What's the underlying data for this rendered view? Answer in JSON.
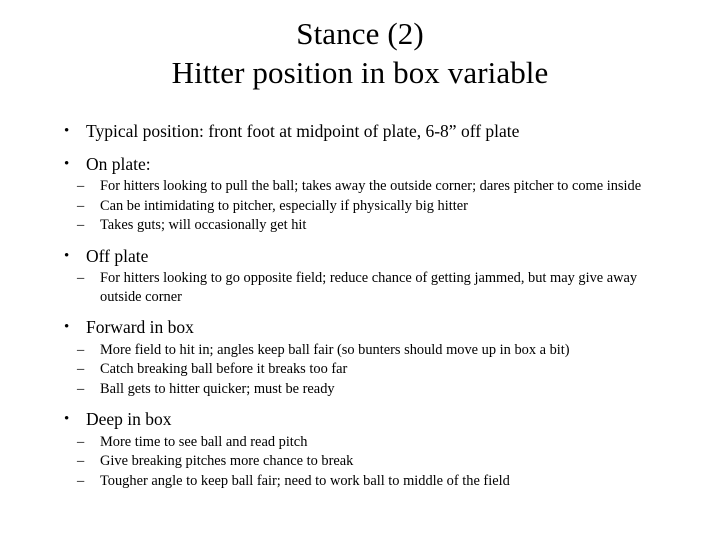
{
  "slide": {
    "background_color": "#ffffff",
    "text_color": "#000000",
    "title": {
      "line1": "Stance (2)",
      "line2": "Hitter position in box variable"
    },
    "bullets": [
      {
        "marker": "•",
        "text": "Typical position: front foot at midpoint of plate, 6-8” off plate",
        "children": []
      },
      {
        "marker": "•",
        "text": "On plate:",
        "children": [
          {
            "marker": "–",
            "text": "For hitters looking to pull the ball; takes away the outside corner; dares pitcher to come inside"
          },
          {
            "marker": "–",
            "text": "Can be intimidating to pitcher, especially if physically big hitter"
          },
          {
            "marker": "–",
            "text": "Takes guts; will occasionally get hit"
          }
        ]
      },
      {
        "marker": "•",
        "text": "Off plate",
        "children": [
          {
            "marker": "–",
            "text": "For hitters looking to go opposite field; reduce chance of getting jammed, but may give away outside corner"
          }
        ]
      },
      {
        "marker": "•",
        "text": "Forward in box",
        "children": [
          {
            "marker": "–",
            "text": "More field to hit in; angles keep ball fair (so bunters should move up in box a bit)"
          },
          {
            "marker": "–",
            "text": "Catch breaking ball before it breaks too far"
          },
          {
            "marker": "–",
            "text": "Ball gets to hitter quicker; must be ready"
          }
        ]
      },
      {
        "marker": "•",
        "text": "Deep in box",
        "children": [
          {
            "marker": "–",
            "text": "More time to see ball and read pitch"
          },
          {
            "marker": "–",
            "text": "Give breaking pitches more chance to break"
          },
          {
            "marker": "–",
            "text": "Tougher angle to keep ball fair; need to work ball to middle of the field"
          }
        ]
      }
    ]
  }
}
